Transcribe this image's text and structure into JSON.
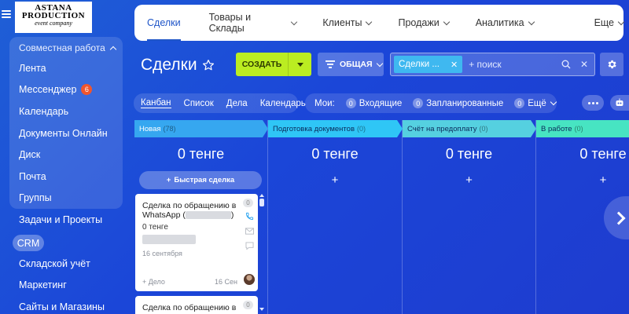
{
  "logo": {
    "line1": "ASTANA",
    "line2": "PRODUCTION",
    "line3": "event company"
  },
  "sidebar": {
    "group_label": "Совместная работа",
    "items": [
      {
        "label": "Лента"
      },
      {
        "label": "Мессенджер",
        "badge": "6"
      },
      {
        "label": "Календарь"
      },
      {
        "label": "Документы Онлайн"
      },
      {
        "label": "Диск"
      },
      {
        "label": "Почта"
      },
      {
        "label": "Группы"
      },
      {
        "label": "Задачи и Проекты"
      },
      {
        "label": "CRM"
      },
      {
        "label": "Складской учёт"
      },
      {
        "label": "Маркетинг"
      },
      {
        "label": "Сайты и Магазины"
      }
    ]
  },
  "topnav": {
    "items": [
      "Сделки",
      "Товары и Склады",
      "Клиенты",
      "Продажи",
      "Аналитика",
      "Еще"
    ]
  },
  "page": {
    "title": "Сделки"
  },
  "toolbar": {
    "create_label": "СОЗДАТЬ",
    "filter_label": "ОБЩАЯ",
    "search_chip": "Сделки ...",
    "search_placeholder": "+ поиск"
  },
  "views": [
    "Канбан",
    "Список",
    "Дела",
    "Календарь"
  ],
  "mine": {
    "label": "Мои:",
    "items": [
      {
        "count": "0",
        "label": "Входящие"
      },
      {
        "count": "0",
        "label": "Запланированные"
      },
      {
        "count": "0",
        "label": "Ещё"
      }
    ]
  },
  "columns": [
    {
      "name": "Новая",
      "count": "(78)",
      "total": "0 тенге",
      "color": "#36a7f0"
    },
    {
      "name": "Подготовка документов",
      "count": "(0)",
      "total": "0 тенге",
      "color": "#2fc6f6"
    },
    {
      "name": "Счёт на предоплату",
      "count": "(0)",
      "total": "0 тенге",
      "color": "#55d0e0"
    },
    {
      "name": "В работе",
      "count": "(0)",
      "total": "0 тенге",
      "color": "#47e4c2"
    }
  ],
  "quick_deal_label": "Быстрая сделка",
  "plus_symbol": "+",
  "cards": [
    {
      "title": "Сделка по обращению в WhatsApp (",
      "title_end": ")",
      "badge": "0",
      "amount": "0 тенге",
      "date": "16 сентября",
      "add_task": "+ Дело",
      "short_date": "16 Сен"
    },
    {
      "title": "Сделка по обращению в",
      "badge": "0"
    }
  ]
}
